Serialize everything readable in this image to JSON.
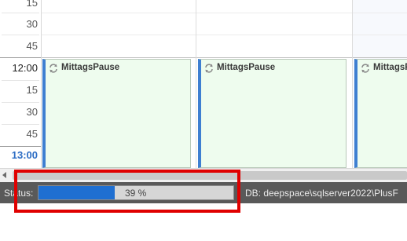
{
  "calendar": {
    "time_labels": [
      {
        "text": "15",
        "kind": "quarter"
      },
      {
        "text": "30",
        "kind": "quarter"
      },
      {
        "text": "45",
        "kind": "quarter"
      },
      {
        "text": "12:00",
        "kind": "hour"
      },
      {
        "text": "15",
        "kind": "quarter"
      },
      {
        "text": "30",
        "kind": "quarter"
      },
      {
        "text": "45",
        "kind": "quarter"
      },
      {
        "text": "13:00",
        "kind": "current"
      }
    ],
    "events": [
      {
        "title": "MittagsPause",
        "icon": "recurrence-icon"
      },
      {
        "title": "MittagsPause",
        "icon": "recurrence-icon"
      },
      {
        "title": "MittagsPause",
        "icon": "recurrence-icon"
      }
    ],
    "colors": {
      "event_bg": "#eefcee",
      "event_accent": "#3e7fd1",
      "current_time": "#2b6cc4"
    }
  },
  "scrollbar": {
    "left_arrow_icon": "arrow-left-icon"
  },
  "status": {
    "label": "Status:",
    "progress_percent": 39,
    "progress_text": "39 %",
    "db_text": "DB: deepspace\\sqlserver2022\\PlusF",
    "colors": {
      "bar_fill": "#1f6fd1",
      "bar_bg": "#d6d6d6",
      "statusbar_bg": "#595959",
      "highlight": "#e00000"
    }
  }
}
